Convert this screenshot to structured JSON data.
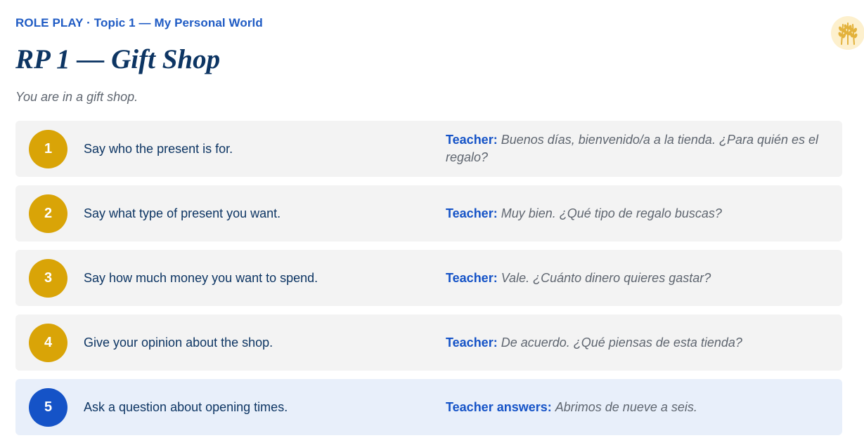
{
  "header": {
    "section": "ROLE PLAY",
    "separator": " · ",
    "topic": "Topic 1 — My Personal World",
    "title": "RP 1 — Gift Shop",
    "subtitle": "You are in a gift shop."
  },
  "logo": {
    "icon": "wheat-icon"
  },
  "colors": {
    "accent": "#1553c7",
    "badge": "#d9a407",
    "title": "#0d3563",
    "highlight_row": "#e8effa",
    "row": "#f3f3f3"
  },
  "tasks": [
    {
      "number": "1",
      "task": "Say who the present is for.",
      "speaker": "Teacher:",
      "line": "Buenos días, bienvenido/a a la tienda. ¿Para quién es el regalo?"
    },
    {
      "number": "2",
      "task": "Say what type of present you want.",
      "speaker": "Teacher:",
      "line": "Muy bien. ¿Qué tipo de regalo buscas?"
    },
    {
      "number": "3",
      "task": "Say how much money you want to spend.",
      "speaker": "Teacher:",
      "line": "Vale. ¿Cuánto dinero quieres gastar?"
    },
    {
      "number": "4",
      "task": "Give your opinion about the shop.",
      "speaker": "Teacher:",
      "line": "De acuerdo. ¿Qué piensas de esta tienda?"
    },
    {
      "number": "5",
      "task": "Ask a question about opening times.",
      "speaker": "Teacher answers:",
      "line": "Abrimos de nueve a seis.",
      "highlighted": true
    }
  ]
}
